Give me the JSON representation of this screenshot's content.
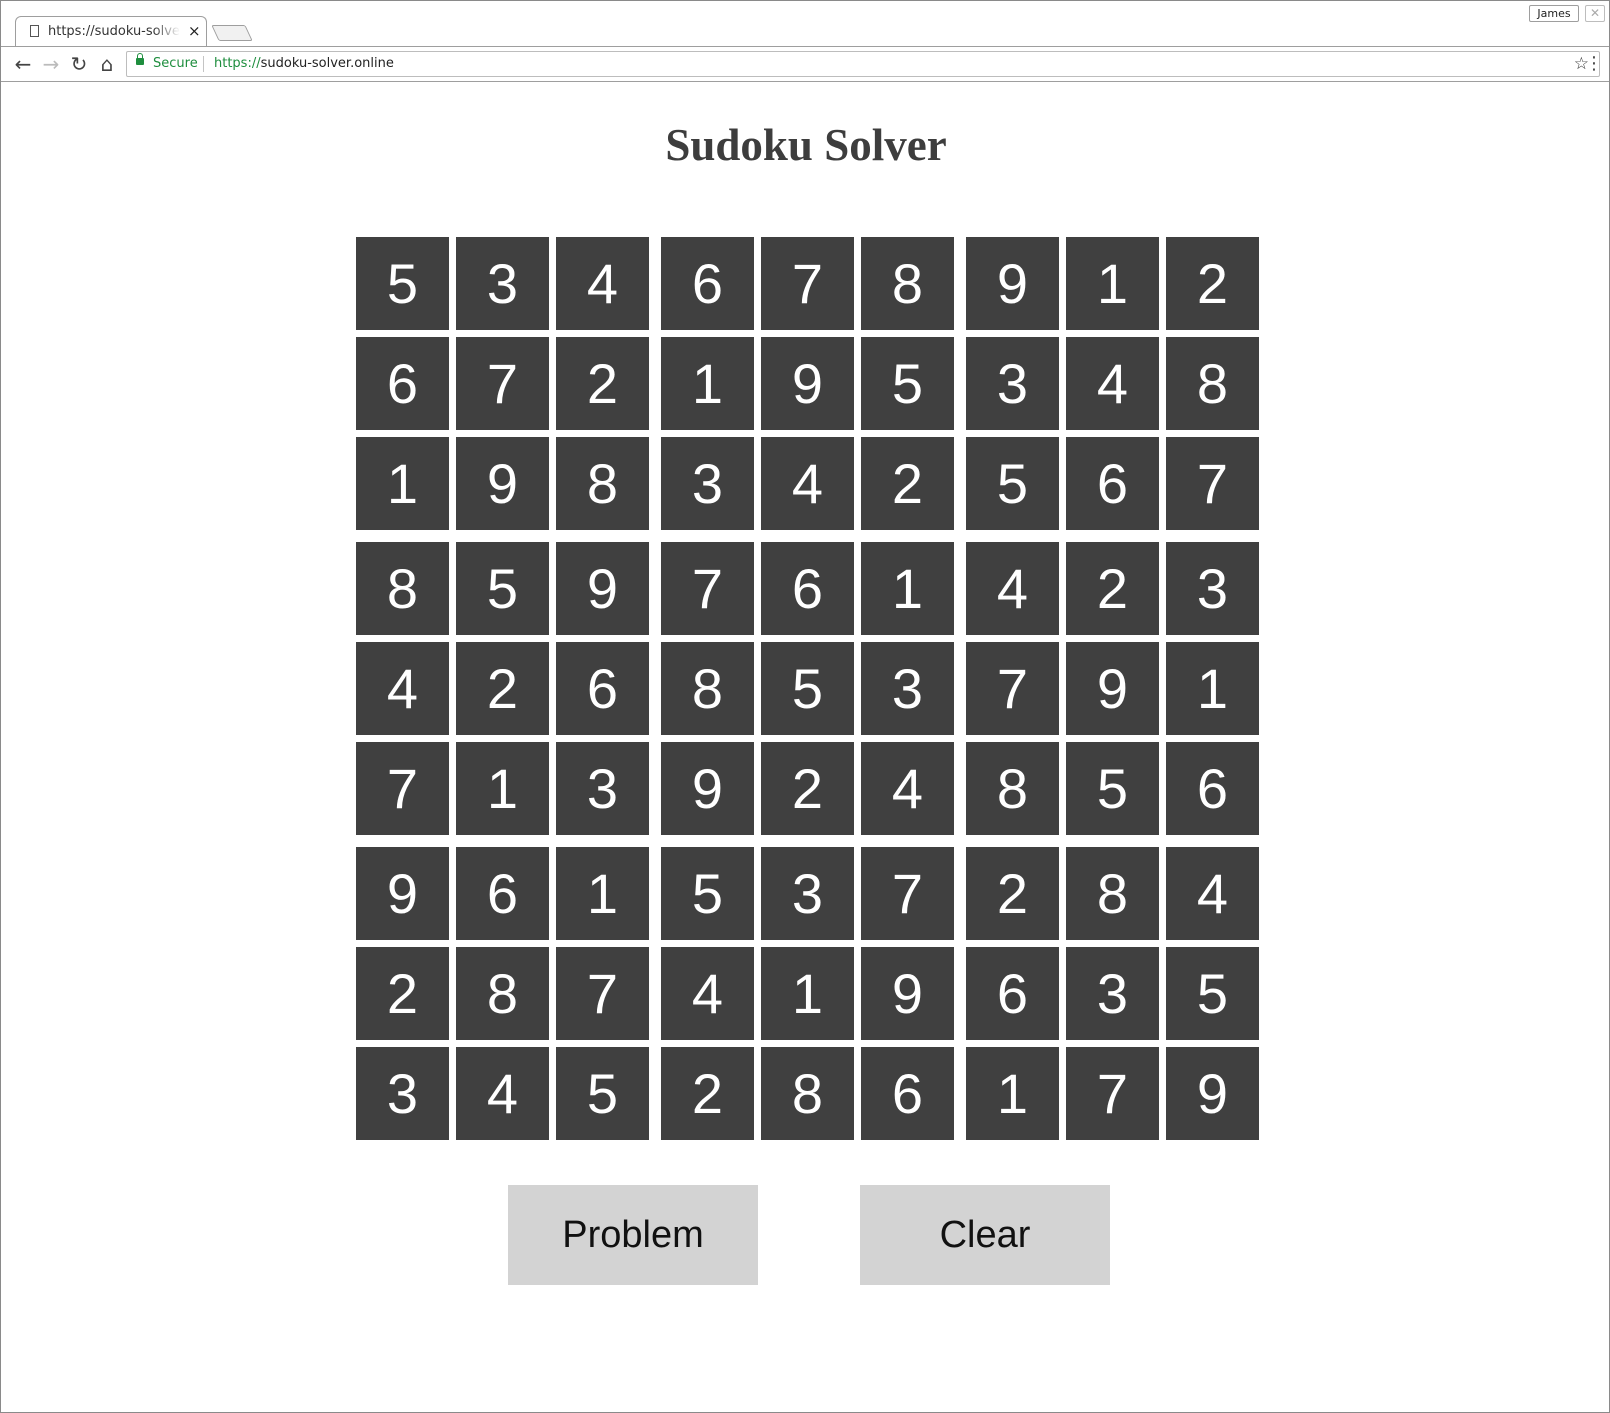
{
  "browser": {
    "tab_title": "https://sudoku-solver.online",
    "tab_close": "×",
    "profile_name": "James",
    "window_close": "✕",
    "secure_label": "Secure",
    "url_scheme": "https://",
    "url_host": "sudoku-solver.online",
    "back": "←",
    "forward": "→",
    "reload": "↻",
    "home": "⌂",
    "bookmark": "☆",
    "menu": "⋮"
  },
  "page": {
    "title": "Sudoku Solver"
  },
  "board": [
    [
      5,
      3,
      4,
      6,
      7,
      8,
      9,
      1,
      2
    ],
    [
      6,
      7,
      2,
      1,
      9,
      5,
      3,
      4,
      8
    ],
    [
      1,
      9,
      8,
      3,
      4,
      2,
      5,
      6,
      7
    ],
    [
      8,
      5,
      9,
      7,
      6,
      1,
      4,
      2,
      3
    ],
    [
      4,
      2,
      6,
      8,
      5,
      3,
      7,
      9,
      1
    ],
    [
      7,
      1,
      3,
      9,
      2,
      4,
      8,
      5,
      6
    ],
    [
      9,
      6,
      1,
      5,
      3,
      7,
      2,
      8,
      4
    ],
    [
      2,
      8,
      7,
      4,
      1,
      9,
      6,
      3,
      5
    ],
    [
      3,
      4,
      5,
      2,
      8,
      6,
      1,
      7,
      9
    ]
  ],
  "buttons": {
    "problem_label": "Problem",
    "clear_label": "Clear"
  },
  "colors": {
    "cell_bg": "#404040",
    "cell_text": "#ffffff",
    "button_bg": "#d3d3d3",
    "secure_green": "#1e8e3e"
  }
}
